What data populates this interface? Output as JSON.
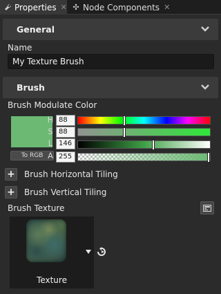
{
  "tabs": [
    {
      "label": "Properties",
      "icon": "wrench-icon",
      "active": true
    },
    {
      "label": "Node Components",
      "icon": "components-icon",
      "active": false
    }
  ],
  "sections": {
    "general": {
      "title": "General",
      "expanded": true
    },
    "brush": {
      "title": "Brush",
      "expanded": true
    }
  },
  "name": {
    "label": "Name",
    "value": "My Texture Brush"
  },
  "color": {
    "label": "Brush Modulate Color",
    "hex": "#6bb973",
    "to_rgb_label": "To RGB",
    "channels": [
      {
        "key": "H",
        "value": "88",
        "fraction": 0.345
      },
      {
        "key": "S",
        "value": "88",
        "fraction": 0.345
      },
      {
        "key": "L",
        "value": "146",
        "fraction": 0.573
      },
      {
        "key": "A",
        "value": "255",
        "fraction": 1.0
      }
    ]
  },
  "tiling": {
    "horizontal_label": "Brush Horizontal Tiling",
    "vertical_label": "Brush Vertical Tiling"
  },
  "texture": {
    "label": "Brush Texture",
    "name": "Texture"
  },
  "colors": {
    "background": "#2b2b2b",
    "section": "#3b3b3b",
    "field": "#1a1a1a"
  }
}
